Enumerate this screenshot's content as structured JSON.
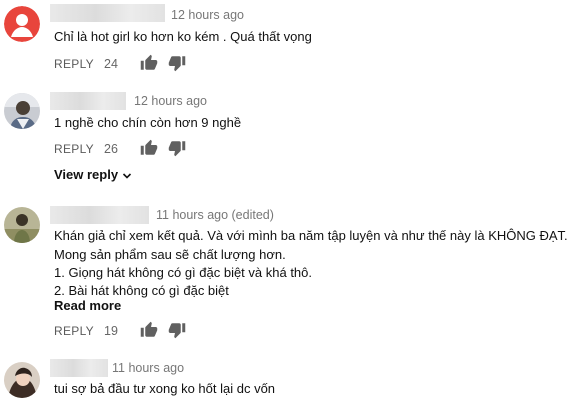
{
  "comments": [
    {
      "time": "12 hours ago",
      "lines": [
        "Chỉ là hot girl ko hơn ko kém . Quá thất vọng"
      ],
      "reply_label": "REPLY",
      "likes": "24"
    },
    {
      "time": "12 hours ago",
      "lines": [
        "1 nghề cho chín còn hơn 9 nghề"
      ],
      "reply_label": "REPLY",
      "likes": "26",
      "view_reply_label": "View reply"
    },
    {
      "time": "11 hours ago (edited)",
      "lines": [
        "Khán giả chỉ xem kết quả. Và với mình ba năm tập luyện và như thế này là KHÔNG ĐẠT.",
        "Mong sản phẩm sau sẽ chất lượng hơn.",
        "1. Giọng hát không có gì đặc biệt và khá thô.",
        "2. Bài hát không có gì đặc biệt"
      ],
      "read_more_label": "Read more",
      "reply_label": "REPLY",
      "likes": "19"
    },
    {
      "time": "11 hours ago",
      "lines": [
        "tui sợ bả đầu tư xong ko hốt lại dc vốn"
      ]
    }
  ],
  "icons": {
    "like": "thumbs-up-icon",
    "dislike": "thumbs-down-icon",
    "expand": "chevron-down-icon"
  },
  "colors": {
    "avatar_red": "#e8453c",
    "text": "#111111",
    "meta": "#777777"
  }
}
